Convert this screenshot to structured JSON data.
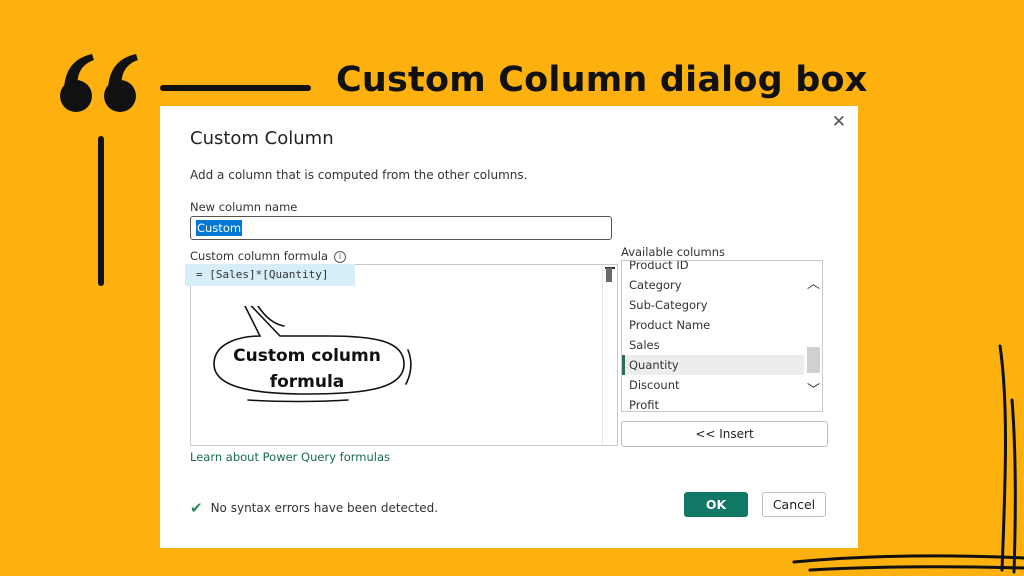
{
  "heading": "Custom Column dialog box",
  "dialog": {
    "close_symbol": "✕",
    "title": "Custom Column",
    "description": "Add a column that is computed from the other columns.",
    "new_column_label": "New column name",
    "new_column_value": "Custom",
    "formula_label": "Custom column formula",
    "info_symbol": "i",
    "formula_text": "= [Sales]*[Quantity]",
    "available_label": "Available columns",
    "available_columns": [
      "Product ID",
      "Category",
      "Sub-Category",
      "Product Name",
      "Sales",
      "Quantity",
      "Discount",
      "Profit"
    ],
    "selected_column": "Quantity",
    "insert_label": "<< Insert",
    "learn_link": "Learn about Power Query formulas",
    "status_text": "No syntax errors have been detected.",
    "ok_label": "OK",
    "cancel_label": "Cancel"
  },
  "annotation": {
    "line1": "Custom column",
    "line2": "formula"
  },
  "colors": {
    "background": "#FDB10F",
    "ok_button": "#117865",
    "selection": "#0078D4"
  }
}
